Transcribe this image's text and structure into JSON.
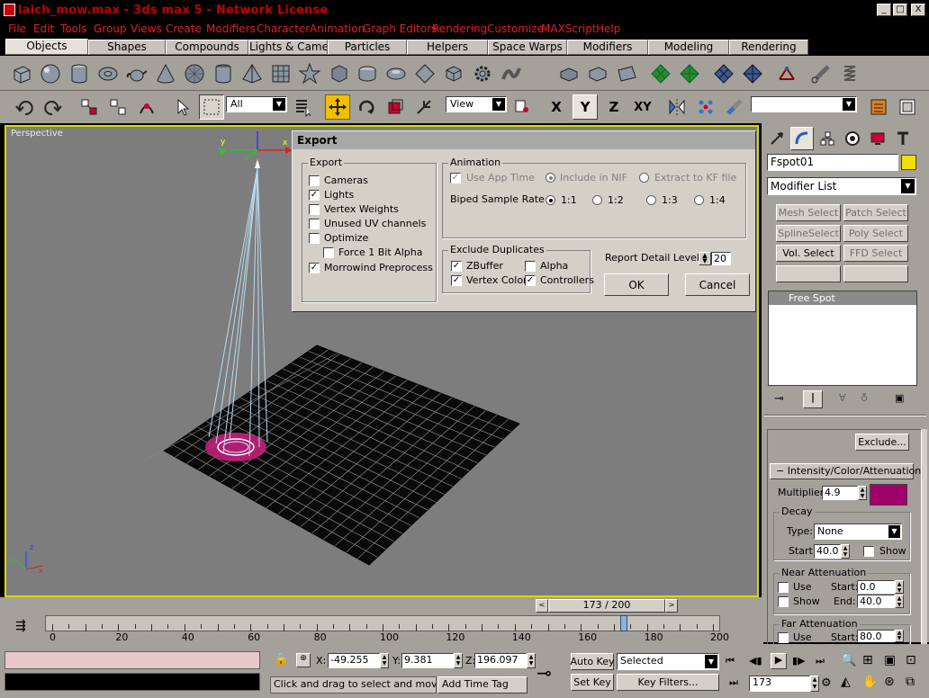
{
  "window": {
    "title": "laich_mow.max - 3ds max 5 - Network License",
    "controls": [
      "_",
      "□",
      "X"
    ]
  },
  "menubar": [
    "File",
    "Edit",
    "Tools",
    "Group",
    "Views",
    "Create",
    "Modifiers",
    "Character",
    "Animation",
    "Graph Editors",
    "Rendering",
    "Customize",
    "MAXScript",
    "Help"
  ],
  "tabs": [
    "Objects",
    "Shapes",
    "Compounds",
    "Lights & Cameras",
    "Particles",
    "Helpers",
    "Space Warps",
    "Modifiers",
    "Modeling",
    "Rendering"
  ],
  "active_tab": "Objects",
  "main_toolbar": {
    "selection_filter": "All",
    "coord_system": "View",
    "axis_x": "X",
    "axis_y": "Y",
    "axis_z": "Z",
    "axis_xy": "XY"
  },
  "viewport": {
    "label": "Perspective",
    "border_color": "#d8d800"
  },
  "export_dialog": {
    "title": "Export",
    "export_group": {
      "label": "Export",
      "items": [
        {
          "label": "Cameras",
          "checked": false
        },
        {
          "label": "Lights",
          "checked": true
        },
        {
          "label": "Vertex Weights",
          "checked": false
        },
        {
          "label": "Unused UV channels",
          "checked": false
        },
        {
          "label": "Optimize",
          "checked": false
        },
        {
          "label": "Force 1 Bit Alpha",
          "checked": false
        },
        {
          "label": "Morrowind Preprocess",
          "checked": true
        }
      ]
    },
    "animation_group": {
      "label": "Animation",
      "use_app_time": "Use App Time",
      "include_in_nif": "Include in NIF",
      "extract_to_kf": "Extract to KF file",
      "biped_label": "Biped Sample Rate",
      "rates": [
        "1:1",
        "1:2",
        "1:3",
        "1:4"
      ],
      "selected_rate": "1:1"
    },
    "exclude_group": {
      "label": "Exclude Duplicates",
      "zbuffer": "ZBuffer",
      "alpha": "Alpha",
      "vertex_colors": "Vertex Colors",
      "controllers": "Controllers"
    },
    "report_detail_label": "Report Detail Level",
    "report_detail_value": "20",
    "ok_label": "OK",
    "cancel_label": "Cancel"
  },
  "command_panel": {
    "object_name": "Fspot01",
    "object_color": "#f0e000",
    "modifier_list": "Modifier List",
    "modifier_buttons": [
      {
        "label": "Mesh Select",
        "enabled": false
      },
      {
        "label": "Patch Select",
        "enabled": false
      },
      {
        "label": "SplineSelect",
        "enabled": false
      },
      {
        "label": "Poly Select",
        "enabled": false
      },
      {
        "label": "Vol. Select",
        "enabled": true
      },
      {
        "label": "FFD Select",
        "enabled": false
      }
    ],
    "stack_item": "Free Spot",
    "exclude_label": "Exclude...",
    "rollout_title": "Intensity/Color/Attenuation",
    "multiplier_label": "Multiplier:",
    "multiplier_value": "4.9",
    "light_color": "#a0006a",
    "decay_label": "Decay",
    "type_label": "Type:",
    "type_value": "None",
    "start_label": "Start:",
    "decay_start_value": "40.0",
    "show_label": "Show",
    "near_atten_label": "Near Attenuation",
    "use_label": "Use",
    "near_start_value": "0.0",
    "end_label": "End:",
    "near_end_value": "40.0",
    "far_atten_label": "Far Attenuation",
    "far_start_value": "80.0"
  },
  "timeline": {
    "frame_display": "173 / 200",
    "current_frame": 173,
    "total_frames": 200,
    "ruler_labels": [
      "0",
      "20",
      "40",
      "60",
      "80",
      "100",
      "120",
      "140",
      "160",
      "180",
      "200"
    ]
  },
  "status": {
    "x_label": "X:",
    "x_value": "-49.255",
    "y_label": "Y:",
    "y_value": "9.381",
    "z_label": "Z:",
    "z_value": "196.097",
    "prompt": "Click and drag to select and move obj",
    "add_time_tag": "Add Time Tag",
    "auto_key": "Auto Key",
    "set_key": "Set Key",
    "selected_dropdown": "Selected",
    "key_filters": "Key Filters...",
    "frame_field": "173"
  }
}
